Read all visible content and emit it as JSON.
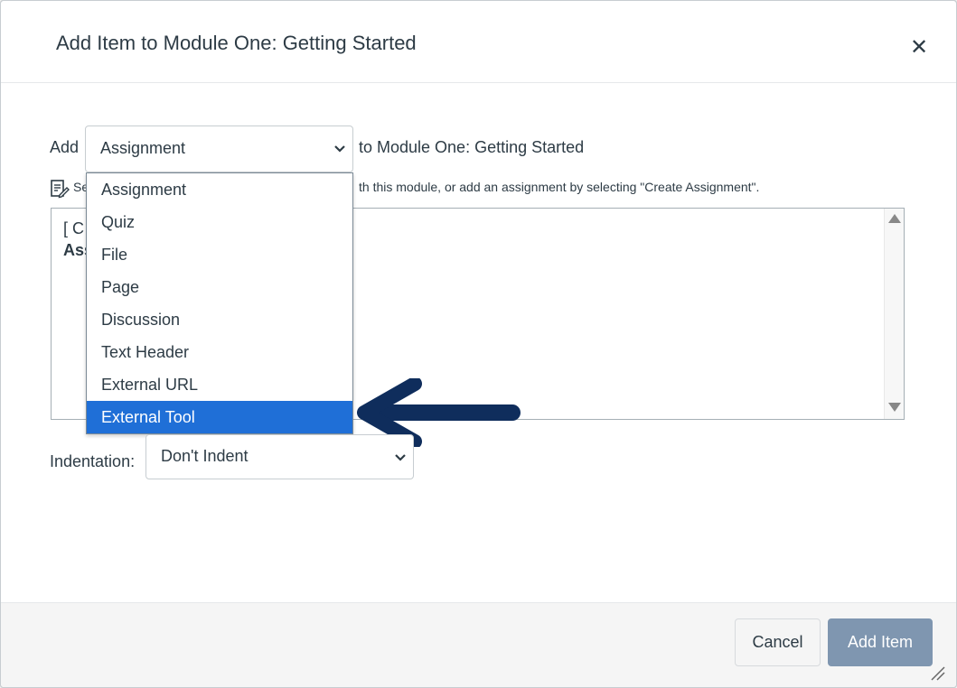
{
  "dialog": {
    "title": "Add Item to Module One: Getting Started",
    "close_icon": "close-icon"
  },
  "add_row": {
    "prefix": "Add",
    "selected_type": "Assignment",
    "suffix": "to Module One: Getting Started"
  },
  "hint": {
    "icon": "edit-document-icon",
    "text_left": "Se",
    "text_right": "th this module, or add an assignment by selecting \"Create Assignment\"."
  },
  "item_list": {
    "visible_fragment_1": "[ C",
    "visible_fragment_2": "Ass"
  },
  "type_dropdown": {
    "options": [
      "Assignment",
      "Quiz",
      "File",
      "Page",
      "Discussion",
      "Text Header",
      "External URL",
      "External Tool"
    ],
    "highlighted": "External Tool",
    "highlight_color": "#1f6fd7"
  },
  "indentation": {
    "label": "Indentation:",
    "value": "Don't Indent"
  },
  "footer": {
    "cancel_label": "Cancel",
    "add_label": "Add Item",
    "add_color": "#7f96b0"
  },
  "annotation": {
    "arrow_color": "#0f2d5c",
    "icon": "left-arrow-icon"
  }
}
